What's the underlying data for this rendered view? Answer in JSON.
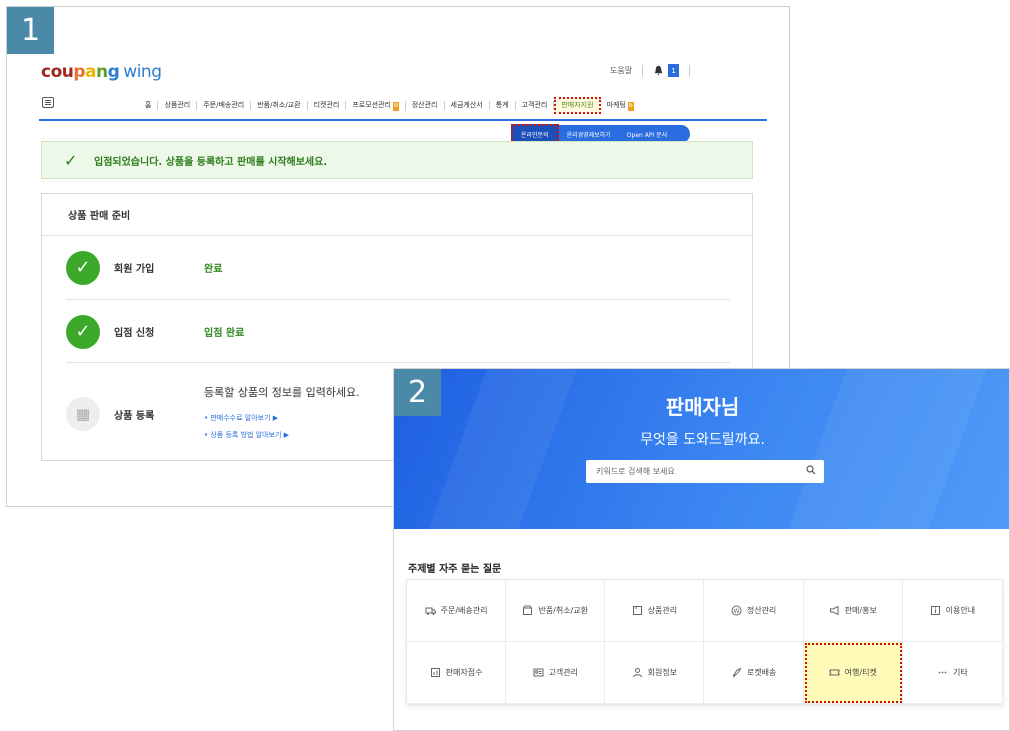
{
  "panel1": {
    "badge": "1",
    "logo": {
      "c1": "cou",
      "c2": "p",
      "c3": "a",
      "c4": "n",
      "c5": "g",
      "wing": "wing"
    },
    "help": "도움말",
    "notif_count": "1",
    "nav": [
      {
        "label": "홈"
      },
      {
        "label": "상품관리"
      },
      {
        "label": "주문/배송관리"
      },
      {
        "label": "반품/취소/교환"
      },
      {
        "label": "티켓관리"
      },
      {
        "label": "프로모션관리",
        "tag": "N"
      },
      {
        "label": "정산관리"
      },
      {
        "label": "세금계산서"
      },
      {
        "label": "통계"
      },
      {
        "label": "고객관리"
      },
      {
        "label": "판매자지원",
        "active": true
      },
      {
        "label": "마케팅",
        "tag": "N"
      }
    ],
    "subnav": [
      "온라인문의",
      "윤리경영제보하기",
      "Open API 문서"
    ],
    "alert": "입점되었습니다. 상품을 등록하고 판매를 시작해보세요.",
    "card_title": "상품 판매 준비",
    "rows": [
      {
        "label": "회원 가입",
        "status": "완료"
      },
      {
        "label": "입점 신청",
        "status": "입점 완료"
      },
      {
        "label": "상품 등록",
        "desc": "등록할 상품의 정보를 입력하세요.",
        "links": [
          "판매수수료 알아보기 ▶",
          "상품 등록 방법 알아보기 ▶"
        ]
      }
    ]
  },
  "panel2": {
    "badge": "2",
    "hero_title": "판매자님",
    "hero_sub": "무엇을 도와드릴까요.",
    "search_placeholder": "키워드로 검색해 보세요",
    "section_title": "주제별 자주 묻는 질문",
    "categories": [
      {
        "label": "주문/배송관리",
        "icon": "truck-icon"
      },
      {
        "label": "반품/취소/교환",
        "icon": "box-icon"
      },
      {
        "label": "상품관리",
        "icon": "product-icon"
      },
      {
        "label": "정산관리",
        "icon": "won-icon"
      },
      {
        "label": "판매/홍보",
        "icon": "megaphone-icon"
      },
      {
        "label": "이용안내",
        "icon": "info-icon"
      },
      {
        "label": "판매자점수",
        "icon": "chart-icon"
      },
      {
        "label": "고객관리",
        "icon": "idcard-icon"
      },
      {
        "label": "회원정보",
        "icon": "person-icon"
      },
      {
        "label": "로켓배송",
        "icon": "rocket-icon"
      },
      {
        "label": "여행/티켓",
        "icon": "ticket-icon",
        "highlight": true
      },
      {
        "label": "기타",
        "icon": "dots-icon"
      }
    ]
  },
  "colors": {
    "accent": "#2a6de0",
    "success": "#3ba82a",
    "highlight_border": "#d01010",
    "badge": "#4a8aa8"
  }
}
